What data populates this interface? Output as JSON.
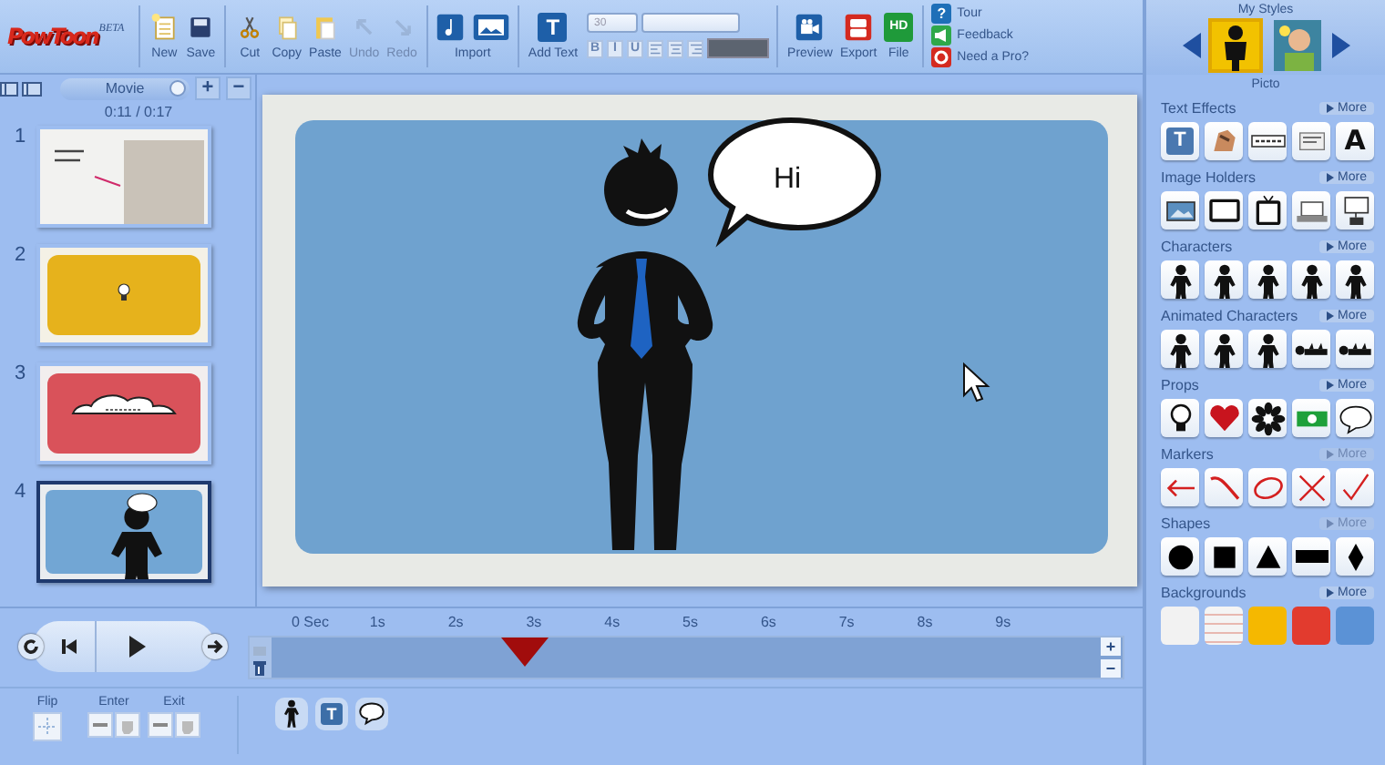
{
  "toolbar": {
    "logo": "PowToon",
    "badge": "BETA",
    "file_buttons": [
      {
        "kind": "new",
        "label": "New",
        "disabled": false
      },
      {
        "kind": "save",
        "label": "Save",
        "disabled": false
      }
    ],
    "edit_buttons": [
      {
        "kind": "cut",
        "label": "Cut",
        "disabled": false
      },
      {
        "kind": "copy",
        "label": "Copy",
        "disabled": false
      },
      {
        "kind": "paste",
        "label": "Paste",
        "disabled": false
      },
      {
        "kind": "undo",
        "label": "Undo",
        "disabled": true
      },
      {
        "kind": "redo",
        "label": "Redo",
        "disabled": true
      }
    ],
    "import": {
      "label": "Import",
      "buttons": [
        {
          "kind": "music"
        },
        {
          "kind": "image"
        }
      ]
    },
    "add_text": {
      "icon": "T",
      "label": "Add Text"
    },
    "font_size": "30",
    "format_buttons": [
      {
        "kind": "char",
        "label": "B"
      },
      {
        "kind": "char",
        "label": "I"
      },
      {
        "kind": "char",
        "label": "U"
      },
      {
        "kind": "align-left"
      },
      {
        "kind": "align-center"
      },
      {
        "kind": "align-right"
      }
    ],
    "publish_buttons": [
      {
        "kind": "preview",
        "label": "Preview"
      },
      {
        "kind": "export",
        "label": "Export"
      },
      {
        "kind": "file",
        "label": "File",
        "icon": "HD"
      }
    ],
    "links": [
      {
        "kind": "help",
        "icon": "?",
        "label": "Tour"
      },
      {
        "kind": "feedback",
        "label": "Feedback"
      },
      {
        "kind": "pro",
        "label": "Need a Pro?"
      }
    ]
  },
  "slides_panel": {
    "tab": "Movie",
    "add": "+",
    "remove": "−",
    "time": "0:11 / 0:17",
    "slides": [
      {
        "number": "1",
        "kind": "photo",
        "selected": false
      },
      {
        "number": "2",
        "kind": "bulb",
        "selected": false
      },
      {
        "number": "3",
        "kind": "cloud",
        "selected": false
      },
      {
        "number": "4",
        "kind": "character",
        "selected": true
      }
    ]
  },
  "stage": {
    "bubble": "Hi"
  },
  "timeline": {
    "ticks": [
      "0 Sec",
      "1s",
      "2s",
      "3s",
      "4s",
      "5s",
      "6s",
      "7s",
      "8s",
      "9s"
    ],
    "level": 0.297,
    "zoom_in": "+",
    "zoom_out": "−"
  },
  "bottom": {
    "flip": "Flip",
    "enter": "Enter",
    "exit": "Exit",
    "add_buttons": [
      {
        "kind": "figure"
      },
      {
        "kind": "text",
        "label": "T"
      },
      {
        "kind": "bubble"
      }
    ]
  },
  "library": {
    "title": "My Styles",
    "style_name": "Picto",
    "styles": [
      {
        "kind": "picto",
        "selected": true
      },
      {
        "kind": "cartoon",
        "selected": false
      }
    ],
    "categories": [
      {
        "title": "Text Effects",
        "more": "More",
        "disabled": false,
        "items": [
          {
            "kind": "text-box",
            "label": "T"
          },
          {
            "kind": "hand"
          },
          {
            "kind": "strip"
          },
          {
            "kind": "card"
          },
          {
            "kind": "letter",
            "label": "A"
          }
        ]
      },
      {
        "title": "Image Holders",
        "more": "More",
        "disabled": false,
        "items": [
          {
            "kind": "picture"
          },
          {
            "kind": "monitor"
          },
          {
            "kind": "tv"
          },
          {
            "kind": "laptop"
          },
          {
            "kind": "projector"
          }
        ]
      },
      {
        "title": "Characters",
        "more": "More",
        "disabled": false,
        "items": [
          {
            "kind": "figure"
          },
          {
            "kind": "figure"
          },
          {
            "kind": "figure"
          },
          {
            "kind": "figure"
          },
          {
            "kind": "figure"
          }
        ]
      },
      {
        "title": "Animated Characters",
        "more": "More",
        "disabled": false,
        "items": [
          {
            "kind": "figure"
          },
          {
            "kind": "figure"
          },
          {
            "kind": "figure"
          },
          {
            "kind": "lying"
          },
          {
            "kind": "lying"
          }
        ]
      },
      {
        "title": "Props",
        "more": "More",
        "disabled": false,
        "items": [
          {
            "kind": "bulb"
          },
          {
            "kind": "heart"
          },
          {
            "kind": "flower"
          },
          {
            "kind": "money"
          },
          {
            "kind": "bubble"
          }
        ]
      },
      {
        "title": "Markers",
        "more": "More",
        "disabled": true,
        "items": [
          {
            "kind": "arrow"
          },
          {
            "kind": "curve"
          },
          {
            "kind": "ellipse"
          },
          {
            "kind": "cross"
          },
          {
            "kind": "check"
          }
        ]
      },
      {
        "title": "Shapes",
        "more": "More",
        "disabled": true,
        "items": [
          {
            "kind": "circle"
          },
          {
            "kind": "square"
          },
          {
            "kind": "triangle"
          },
          {
            "kind": "rectangle"
          },
          {
            "kind": "diamond"
          }
        ]
      },
      {
        "title": "Backgrounds",
        "more": "More",
        "disabled": false,
        "items": [
          {
            "kind": "swatch",
            "color": "#f2f2f2"
          },
          {
            "kind": "lined",
            "color": "#f4f4f4"
          },
          {
            "kind": "swatch",
            "color": "#f5b800"
          },
          {
            "kind": "swatch",
            "color": "#e23b2e"
          },
          {
            "kind": "swatch",
            "color": "#5b92d6"
          }
        ]
      }
    ]
  }
}
